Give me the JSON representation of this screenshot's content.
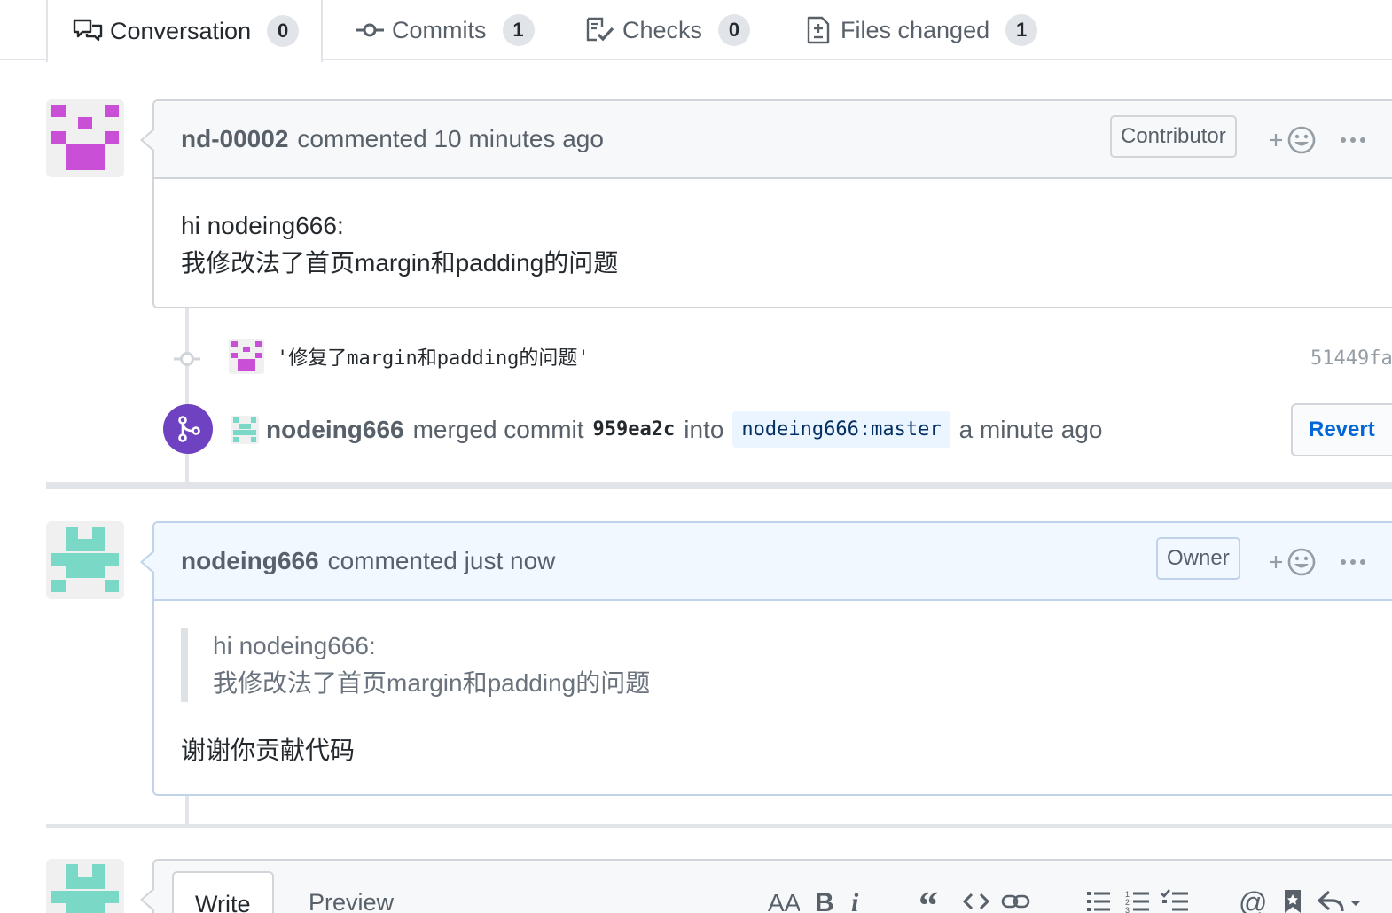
{
  "tabs": {
    "conversation": {
      "label": "Conversation",
      "count": "0"
    },
    "commits": {
      "label": "Commits",
      "count": "1"
    },
    "checks": {
      "label": "Checks",
      "count": "0"
    },
    "files": {
      "label": "Files changed",
      "count": "1"
    }
  },
  "comment1": {
    "author": "nd-00002",
    "meta": "commented 10 minutes ago",
    "role": "Contributor",
    "body_line1": "hi nodeing666:",
    "body_line2": "我修改法了首页margin和padding的问题"
  },
  "commit": {
    "message": "'修复了margin和padding的问题'",
    "sha": "51449fa"
  },
  "merge": {
    "author": "nodeing666",
    "action": "merged commit",
    "sha": "959ea2c",
    "into": "into",
    "branch": "nodeing666:master",
    "time": "a minute ago",
    "revert_label": "Revert"
  },
  "comment2": {
    "author": "nodeing666",
    "meta": "commented just now",
    "role": "Owner",
    "quote_line1": "hi nodeing666:",
    "quote_line2": "我修改法了首页margin和padding的问题",
    "body": "谢谢你贡献代码"
  },
  "form": {
    "write_label": "Write",
    "preview_label": "Preview"
  },
  "colors": {
    "merge_purple": "#6f42c1",
    "link_blue": "#0366d6",
    "avatar_magenta": "#c94fd6",
    "avatar_teal": "#7ad9c6"
  },
  "icons": [
    "comment-discussion-icon",
    "git-commit-icon",
    "checklist-icon",
    "file-diff-icon",
    "smiley-icon",
    "kebab-horizontal-icon",
    "git-merge-icon",
    "heading-icon",
    "bold-icon",
    "italic-icon",
    "quote-icon",
    "code-icon",
    "link-icon",
    "list-unordered-icon",
    "list-ordered-icon",
    "tasklist-icon",
    "mention-icon",
    "bookmark-icon",
    "reply-icon"
  ]
}
